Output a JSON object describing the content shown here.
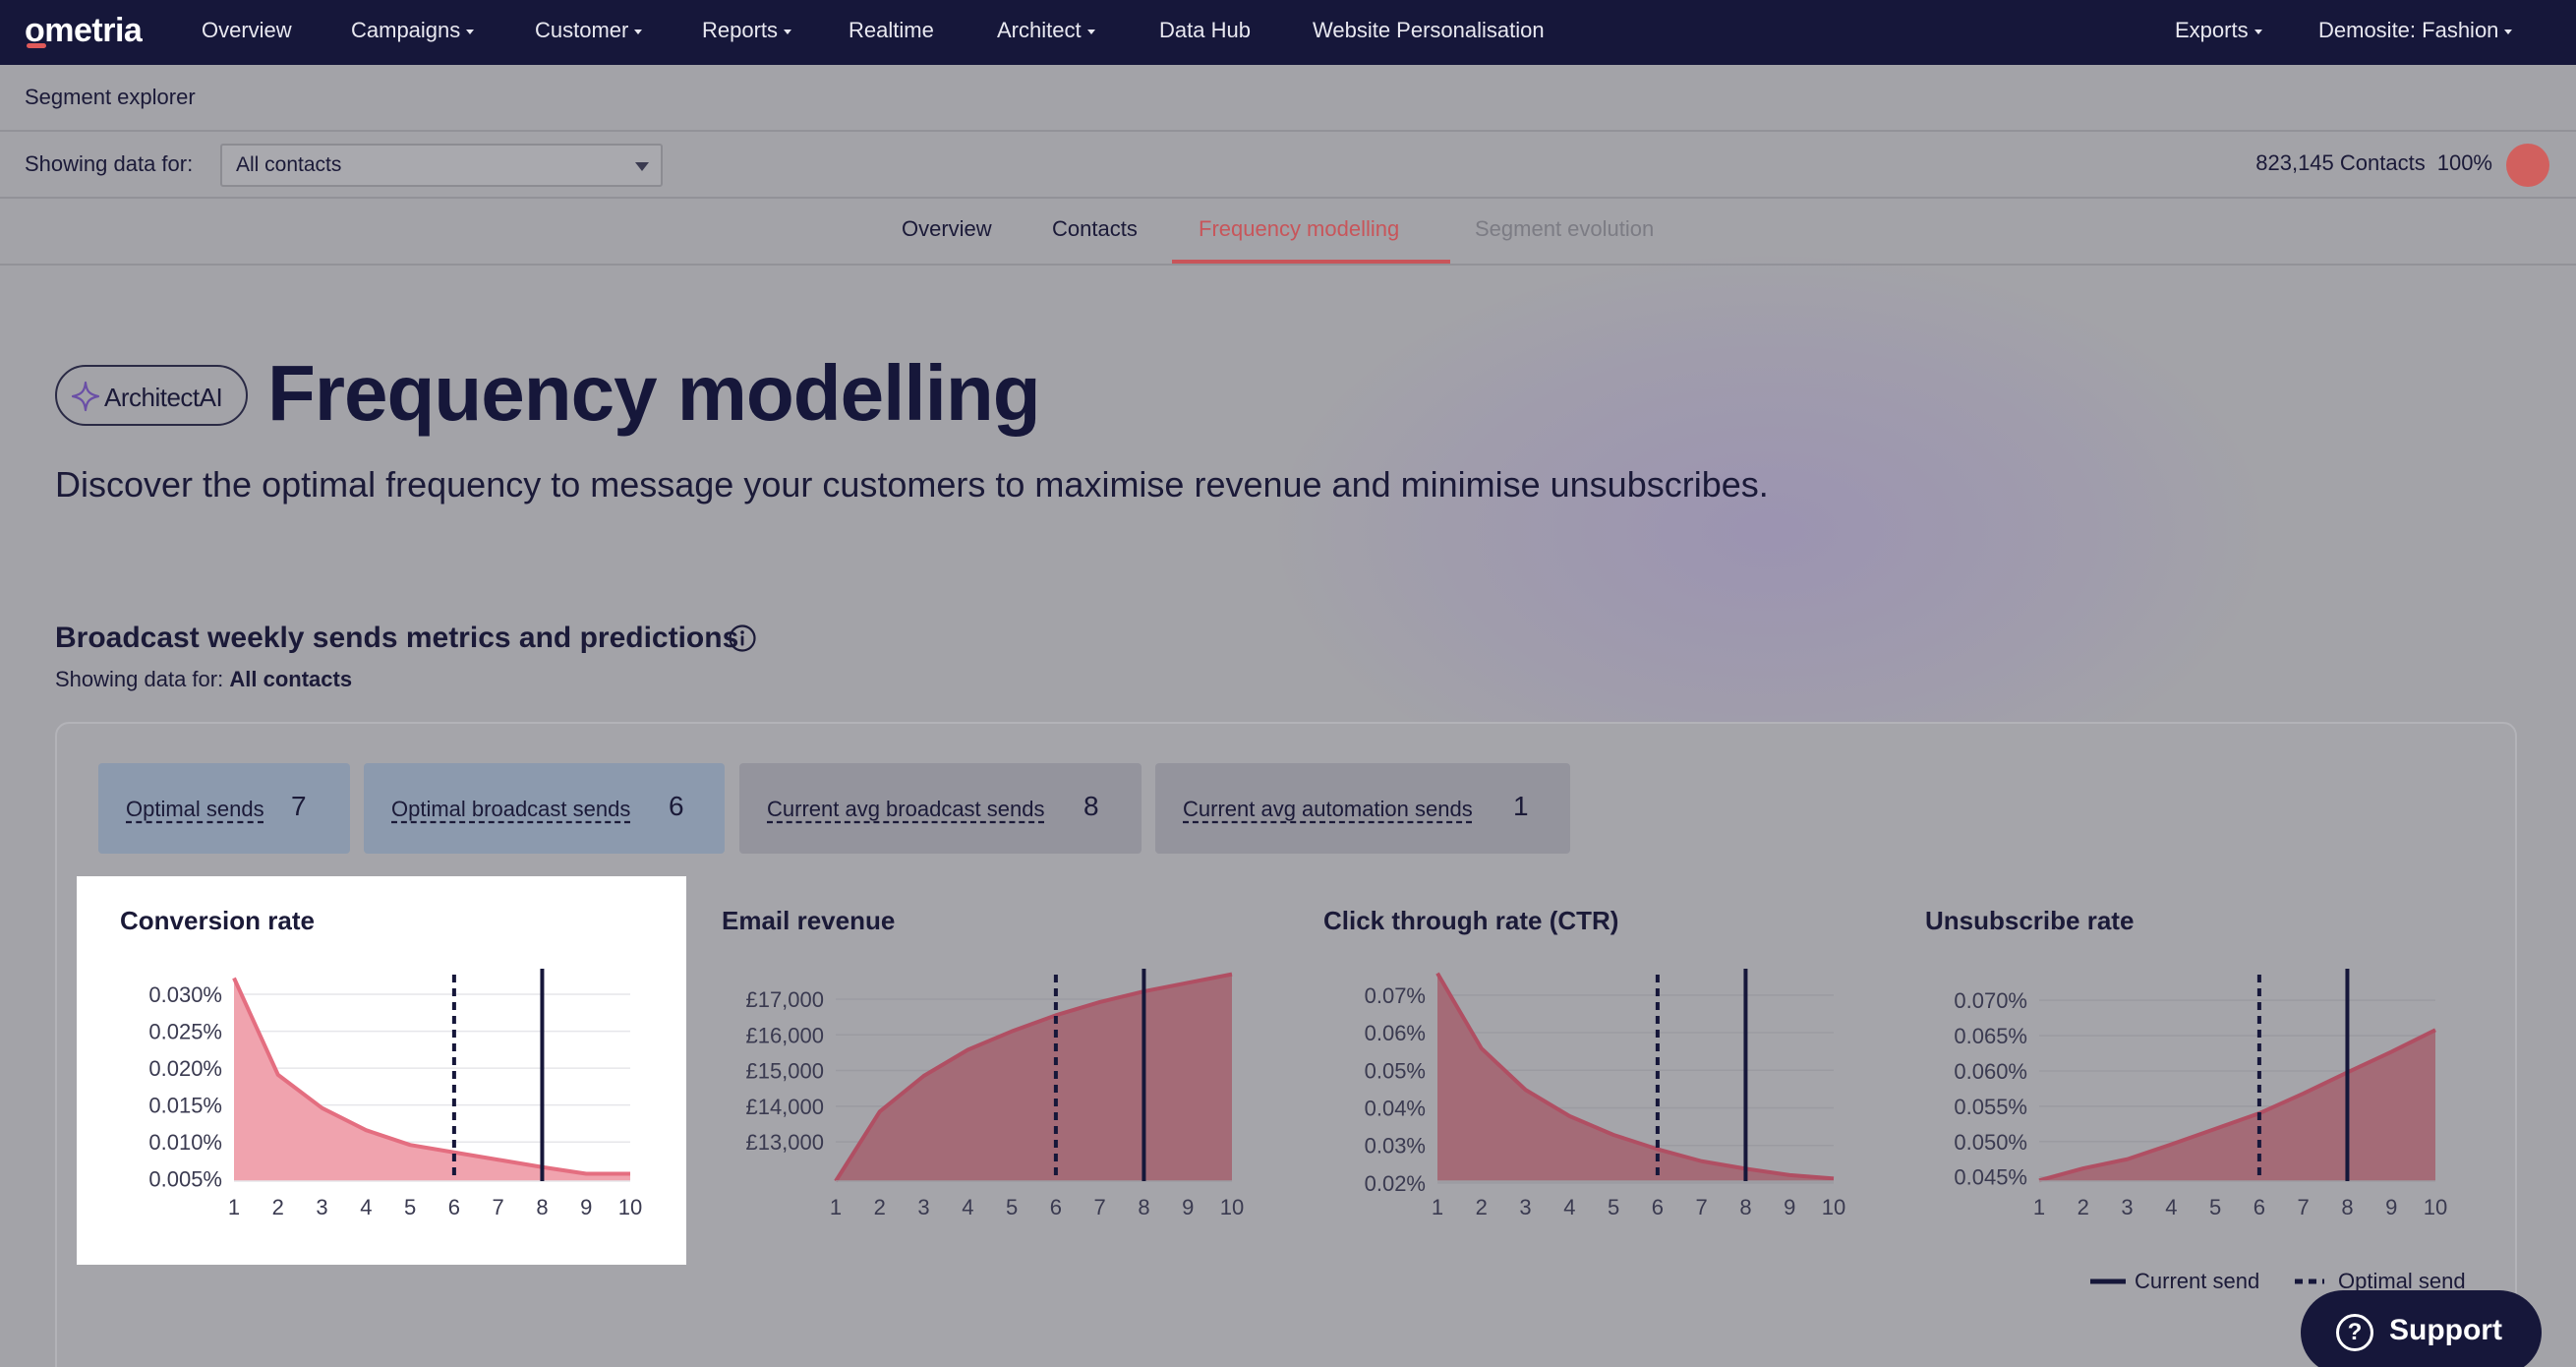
{
  "nav": {
    "logo": "ometria",
    "items": [
      {
        "label": "Overview",
        "caret": false
      },
      {
        "label": "Campaigns",
        "caret": true
      },
      {
        "label": "Customer",
        "caret": true
      },
      {
        "label": "Reports",
        "caret": true
      },
      {
        "label": "Realtime",
        "caret": false
      },
      {
        "label": "Architect",
        "caret": true
      },
      {
        "label": "Data Hub",
        "caret": false
      },
      {
        "label": "Website Personalisation",
        "caret": false
      }
    ],
    "right": [
      {
        "label": "Exports",
        "caret": true
      },
      {
        "label": "Demosite: Fashion",
        "caret": true
      }
    ]
  },
  "page_header": "Segment explorer",
  "filter": {
    "label": "Showing data for:",
    "selected": "All contacts",
    "contacts_count": "823,145 Contacts",
    "percent": "100%"
  },
  "tabs": [
    {
      "label": "Overview",
      "state": "normal"
    },
    {
      "label": "Contacts",
      "state": "normal"
    },
    {
      "label": "Frequency modelling",
      "state": "active"
    },
    {
      "label": "Segment evolution",
      "state": "disabled"
    }
  ],
  "hero": {
    "badge": "ArchitectAI",
    "title": "Frequency modelling",
    "subtitle": "Discover the optimal frequency to message your customers to maximise revenue and minimise unsubscribes."
  },
  "section": {
    "title": "Broadcast weekly sends metrics and predictions",
    "showing_prefix": "Showing data for:",
    "showing_value": "All contacts"
  },
  "stats": [
    {
      "label": "Optimal sends",
      "value": "7"
    },
    {
      "label": "Optimal broadcast sends",
      "value": "6"
    },
    {
      "label": "Current avg broadcast sends",
      "value": "8"
    },
    {
      "label": "Current avg automation sends",
      "value": "1"
    }
  ],
  "legend": {
    "current": "Current send",
    "optimal": "Optimal send"
  },
  "support_label": "Support",
  "colors": {
    "nav_bg": "#16173a",
    "accent": "#c8555a",
    "area_fill": "#f0a3ae",
    "area_line": "#e46e80"
  },
  "chart_data": [
    {
      "type": "area",
      "title": "Conversion rate",
      "x": [
        1,
        2,
        3,
        4,
        5,
        6,
        7,
        8,
        9,
        10
      ],
      "y": [
        0.0322,
        0.0191,
        0.0146,
        0.0116,
        0.0096,
        0.0086,
        0.0076,
        0.0066,
        0.0057,
        0.0057
      ],
      "yticks": [
        "0.030%",
        "0.025%",
        "0.020%",
        "0.015%",
        "0.010%",
        "0.005%"
      ],
      "ytick_values": [
        0.03,
        0.025,
        0.02,
        0.015,
        0.01,
        0.005
      ],
      "ylim": [
        0.0047,
        0.0332
      ],
      "optimal_send": 6,
      "current_send": 8
    },
    {
      "type": "area",
      "title": "Email revenue",
      "x": [
        1,
        2,
        3,
        4,
        5,
        6,
        7,
        8,
        9,
        10
      ],
      "y": [
        11900,
        13850,
        14850,
        15580,
        16100,
        16550,
        16920,
        17220,
        17460,
        17700
      ],
      "yticks": [
        "£17,000",
        "£16,000",
        "£15,000",
        "£14,000",
        "£13,000"
      ],
      "ytick_values": [
        17000,
        16000,
        15000,
        14000,
        13000
      ],
      "ylim": [
        11900,
        17800
      ],
      "optimal_send": 6,
      "current_send": 8
    },
    {
      "type": "area",
      "title": "Click through rate (CTR)",
      "x": [
        1,
        2,
        3,
        4,
        5,
        6,
        7,
        8,
        9,
        10
      ],
      "y": [
        0.0758,
        0.0558,
        0.0448,
        0.0378,
        0.0328,
        0.029,
        0.0258,
        0.0238,
        0.0221,
        0.0212
      ],
      "yticks": [
        "0.07%",
        "0.06%",
        "0.05%",
        "0.04%",
        "0.03%",
        "0.02%"
      ],
      "ytick_values": [
        0.07,
        0.06,
        0.05,
        0.04,
        0.03,
        0.02
      ],
      "ylim": [
        0.0205,
        0.0765
      ],
      "optimal_send": 6,
      "current_send": 8
    },
    {
      "type": "area",
      "title": "Unsubscribe rate",
      "x": [
        1,
        2,
        3,
        4,
        5,
        6,
        7,
        8,
        9,
        10
      ],
      "y": [
        0.0445,
        0.0462,
        0.0475,
        0.0496,
        0.0518,
        0.054,
        0.0568,
        0.0598,
        0.0627,
        0.0658
      ],
      "yticks": [
        "0.070%",
        "0.065%",
        "0.060%",
        "0.055%",
        "0.050%",
        "0.045%"
      ],
      "ytick_values": [
        0.07,
        0.065,
        0.06,
        0.055,
        0.05,
        0.045
      ],
      "ylim": [
        0.0444,
        0.0742
      ],
      "optimal_send": 6,
      "current_send": 8
    }
  ]
}
